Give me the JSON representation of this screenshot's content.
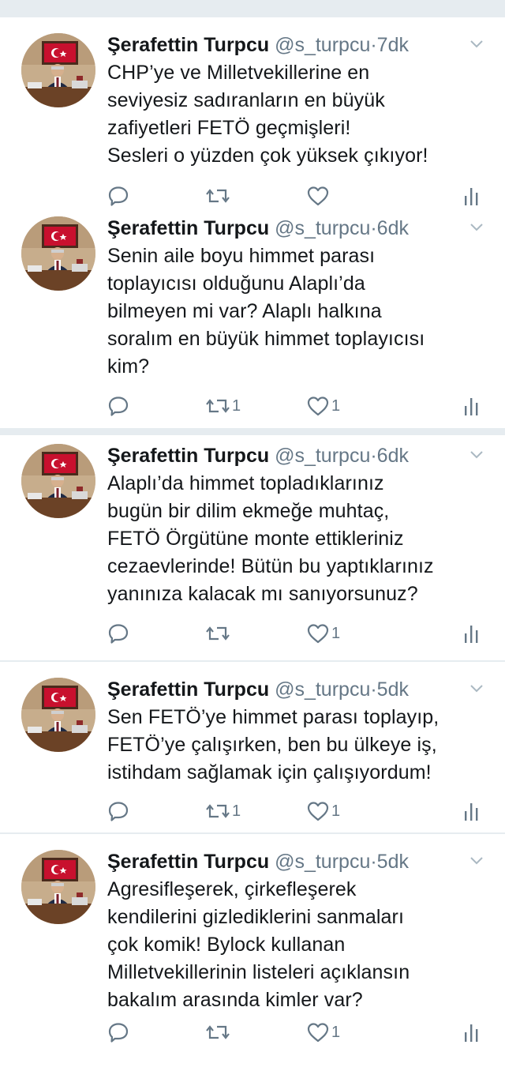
{
  "colors": {
    "page_bg": "#ffffff",
    "separator": "#e6ecf0",
    "name": "#14171a",
    "secondary": "#657786",
    "icon": "#657786"
  },
  "tweets": [
    {
      "author": "Şerafettin Turpcu",
      "handle": "@s_turpcu",
      "dot": "·",
      "time": "7dk",
      "lines": [
        "CHP’ye ve Milletvekillerine en",
        "seviyesiz sadıranların en büyük",
        "zafiyetleri FETÖ geçmişleri!",
        "Sesleri o yüzden çok yüksek çıkıyor!"
      ],
      "retweet_count": "",
      "like_count": ""
    },
    {
      "author": "Şerafettin Turpcu",
      "handle": "@s_turpcu",
      "dot": "·",
      "time": "6dk",
      "lines": [
        "Senin aile boyu himmet parası",
        "toplayıcısı olduğunu Alaplı’da",
        "bilmeyen mi var? Alaplı halkına",
        "soralım en büyük himmet toplayıcısı",
        "kim?"
      ],
      "retweet_count": "1",
      "like_count": "1"
    },
    {
      "author": "Şerafettin Turpcu",
      "handle": "@s_turpcu",
      "dot": "·",
      "time": "6dk",
      "lines": [
        "Alaplı’da himmet topladıklarınız",
        "bugün bir dilim ekmeğe muhtaç,",
        "FETÖ Örgütüne monte ettikleriniz",
        "cezaevlerinde! Bütün bu yaptıklarınız",
        "yanınıza kalacak mı sanıyorsunuz?"
      ],
      "retweet_count": "",
      "like_count": "1"
    },
    {
      "author": "Şerafettin Turpcu",
      "handle": "@s_turpcu",
      "dot": "·",
      "time": "5dk",
      "lines": [
        "Sen FETÖ’ye himmet parası toplayıp,",
        "FETÖ’ye çalışırken, ben bu ülkeye iş,",
        "istihdam sağlamak için çalışıyordum!"
      ],
      "retweet_count": "1",
      "like_count": "1"
    },
    {
      "author": "Şerafettin Turpcu",
      "handle": "@s_turpcu",
      "dot": "·",
      "time": "5dk",
      "lines": [
        "Agresifleşerek, çirkefleşerek",
        "kendilerini gizlediklerini sanmaları",
        "çok komik! Bylock kullanan",
        "Milletvekillerinin listeleri açıklansın",
        "bakalım arasında kimler var?"
      ],
      "retweet_count": "",
      "like_count": "1"
    }
  ],
  "icons": {
    "reply": "reply-icon",
    "retweet": "retweet-icon",
    "like": "heart-icon",
    "analytics": "analytics-icon",
    "more": "chevron-down-icon"
  }
}
